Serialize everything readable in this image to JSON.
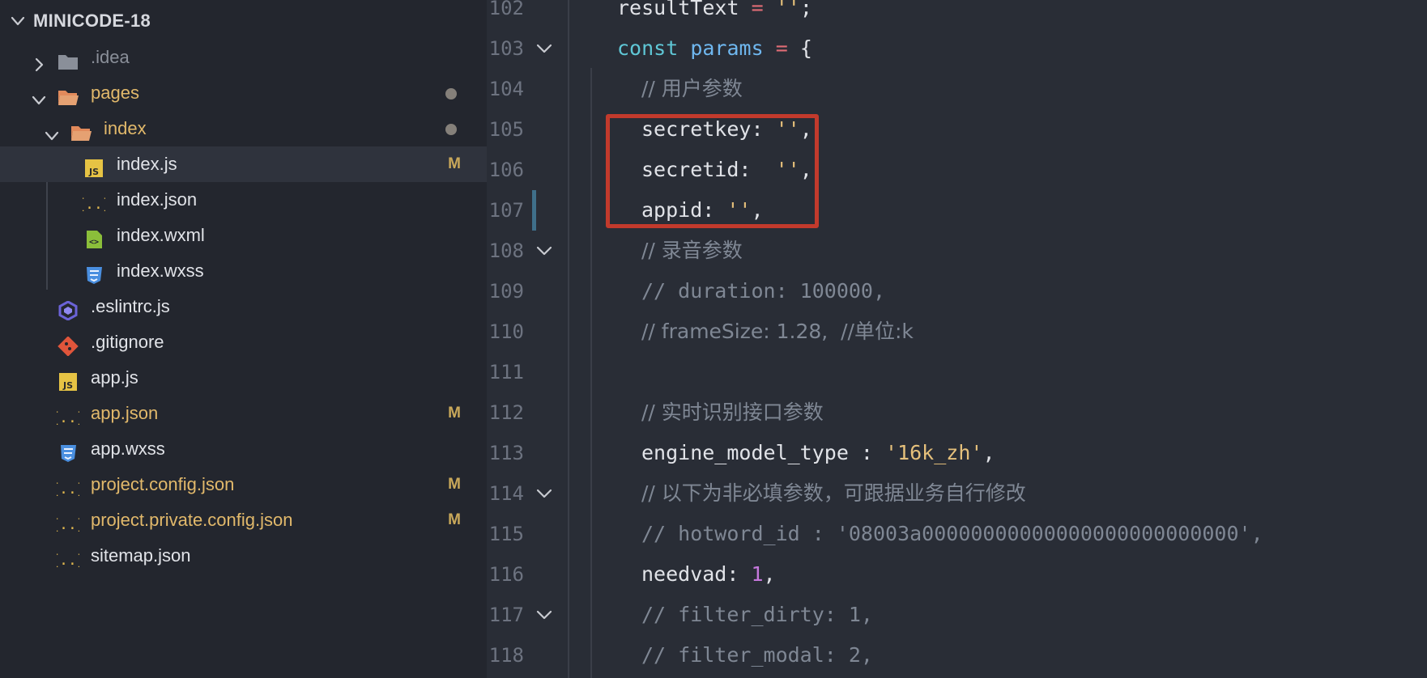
{
  "sidebar": {
    "header_title": "MINICODE-18",
    "items": [
      {
        "label": ".idea",
        "icon": "folder-icon",
        "color": "#8a8f99",
        "badge": "",
        "dot": false
      },
      {
        "label": "pages",
        "icon": "folder-open-icon",
        "color": "#e2b96b",
        "badge": "",
        "dot": true
      },
      {
        "label": "index",
        "icon": "folder-open-icon",
        "color": "#e2b96b",
        "badge": "",
        "dot": true
      },
      {
        "label": "index.js",
        "icon": "js-file-icon",
        "color": "#e1e3e8",
        "badge": "M",
        "dot": false
      },
      {
        "label": "index.json",
        "icon": "json-file-icon",
        "color": "#e1e3e8",
        "badge": "",
        "dot": false
      },
      {
        "label": "index.wxml",
        "icon": "wxml-file-icon",
        "color": "#e1e3e8",
        "badge": "",
        "dot": false
      },
      {
        "label": "index.wxss",
        "icon": "css-file-icon",
        "color": "#e1e3e8",
        "badge": "",
        "dot": false
      },
      {
        "label": ".eslintrc.js",
        "icon": "eslint-icon",
        "color": "#e1e3e8",
        "badge": "",
        "dot": false
      },
      {
        "label": ".gitignore",
        "icon": "git-icon",
        "color": "#e1e3e8",
        "badge": "",
        "dot": false
      },
      {
        "label": "app.js",
        "icon": "js-file-icon",
        "color": "#e1e3e8",
        "badge": "",
        "dot": false
      },
      {
        "label": "app.json",
        "icon": "json-file-icon",
        "color": "#e2b96b",
        "badge": "M",
        "dot": false
      },
      {
        "label": "app.wxss",
        "icon": "css-file-icon",
        "color": "#e1e3e8",
        "badge": "",
        "dot": false
      },
      {
        "label": "project.config.json",
        "icon": "json-file-icon",
        "color": "#e2b96b",
        "badge": "M",
        "dot": false
      },
      {
        "label": "project.private.config.json",
        "icon": "json-file-icon",
        "color": "#e2b96b",
        "badge": "M",
        "dot": false
      },
      {
        "label": "sitemap.json",
        "icon": "json-file-icon",
        "color": "#e1e3e8",
        "badge": "",
        "dot": false
      }
    ],
    "badge_color": "#c9a85a"
  },
  "editor": {
    "line_numbers": [
      "102",
      "103",
      "104",
      "105",
      "106",
      "107",
      "108",
      "109",
      "110",
      "111",
      "112",
      "113",
      "114",
      "115",
      "116",
      "117",
      "118"
    ],
    "lines": [
      [
        {
          "t": "resultText ",
          "c": "t-prop"
        },
        {
          "t": "=",
          "c": "t-op"
        },
        {
          "t": " ",
          "c": "t-punc"
        },
        {
          "t": "''",
          "c": "t-str"
        },
        {
          "t": ";",
          "c": "t-punc"
        }
      ],
      [
        {
          "t": "const",
          "c": "t-kw"
        },
        {
          "t": " ",
          "c": "t-punc"
        },
        {
          "t": "params",
          "c": "t-var"
        },
        {
          "t": " ",
          "c": "t-punc"
        },
        {
          "t": "=",
          "c": "t-op"
        },
        {
          "t": " {",
          "c": "t-punc"
        }
      ],
      [
        {
          "t": "// 用户参数",
          "c": "t-cmt"
        }
      ],
      [
        {
          "t": "secretkey: ",
          "c": "t-prop"
        },
        {
          "t": "''",
          "c": "t-str"
        },
        {
          "t": ",",
          "c": "t-punc"
        }
      ],
      [
        {
          "t": "secretid:  ",
          "c": "t-prop"
        },
        {
          "t": "''",
          "c": "t-str"
        },
        {
          "t": ",",
          "c": "t-punc"
        }
      ],
      [
        {
          "t": "appid: ",
          "c": "t-prop"
        },
        {
          "t": "''",
          "c": "t-str"
        },
        {
          "t": ",",
          "c": "t-punc"
        }
      ],
      [
        {
          "t": "// 录音参数",
          "c": "t-cmt"
        }
      ],
      [
        {
          "t": "// duration: 100000,",
          "c": "t-cmt"
        }
      ],
      [
        {
          "t": "// frameSize: 1.28,  //单位:k",
          "c": "t-cmt"
        }
      ],
      [],
      [
        {
          "t": "// 实时识别接口参数",
          "c": "t-cmt"
        }
      ],
      [
        {
          "t": "engine_model_type : ",
          "c": "t-prop"
        },
        {
          "t": "'16k_zh'",
          "c": "t-str"
        },
        {
          "t": ",",
          "c": "t-punc"
        }
      ],
      [
        {
          "t": "// 以下为非必填参数，可跟据业务自行修改",
          "c": "t-cmt"
        }
      ],
      [
        {
          "t": "// hotword_id : '08003a00000000000000000000000000',",
          "c": "t-cmt"
        }
      ],
      [
        {
          "t": "needvad: ",
          "c": "t-prop"
        },
        {
          "t": "1",
          "c": "t-num"
        },
        {
          "t": ",",
          "c": "t-punc"
        }
      ],
      [
        {
          "t": "// filter_dirty: 1,",
          "c": "t-cmt"
        }
      ],
      [
        {
          "t": "// filter_modal: 2,",
          "c": "t-cmt"
        }
      ]
    ],
    "fold_lines": [
      "103",
      "108",
      "114",
      "117"
    ],
    "modified_line": "107",
    "highlight_color": "#c23a2c"
  }
}
